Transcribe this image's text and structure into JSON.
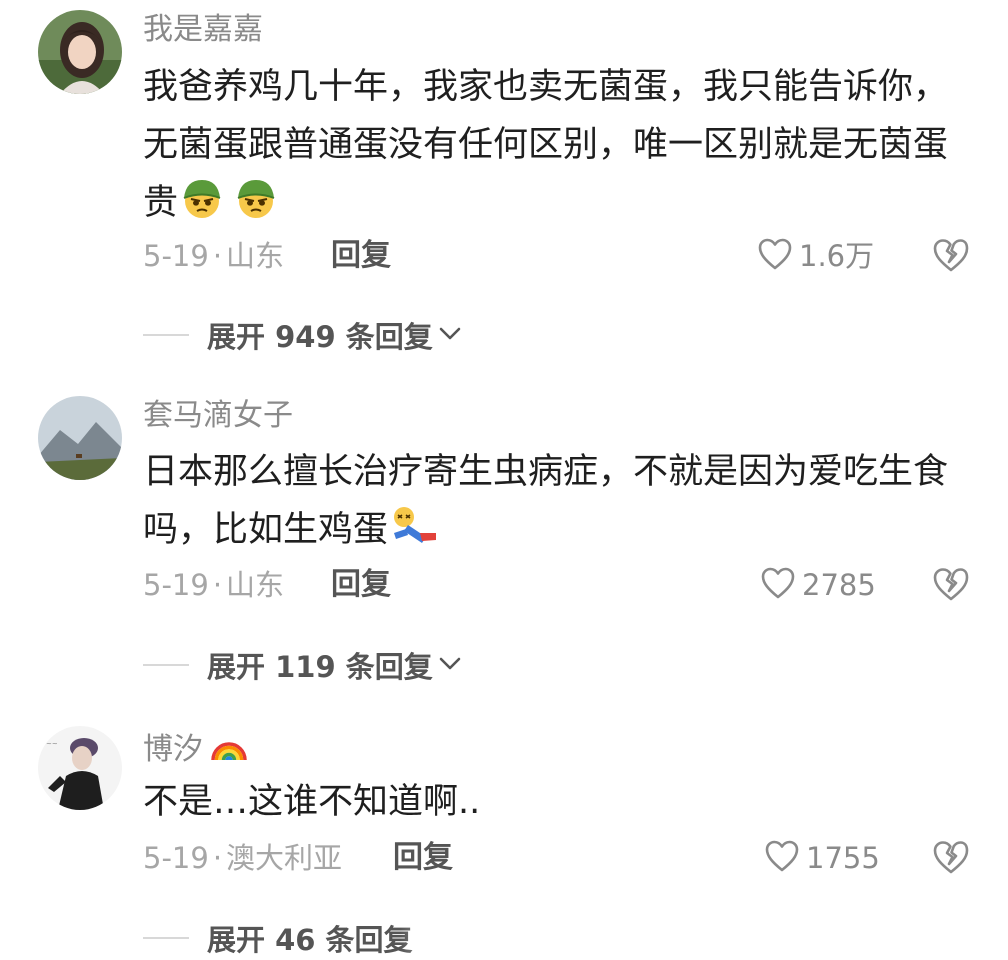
{
  "comments": [
    {
      "username": "我是嘉嘉",
      "text": "我爸养鸡几十年，我家也卖无菌蛋，我只能告诉你，无菌蛋跟普通蛋没有任何区别，唯一区别就是无茵蛋贵",
      "text_emojis": [
        "soldier-face-emoji",
        "soldier-face-emoji"
      ],
      "date": "5-19",
      "separator": "·",
      "location": "山东",
      "reply_label": "回复",
      "likes": "1.6万",
      "expand_label": "展开 949 条回复"
    },
    {
      "username": "套马滴女子",
      "text": "日本那么擅长治疗寄生虫病症，不就是因为爱吃生食吗，比如生鸡蛋",
      "text_emojis": [
        "fainted-person-emoji"
      ],
      "date": "5-19",
      "separator": "·",
      "location": "山东",
      "reply_label": "回复",
      "likes": "2785",
      "expand_label": "展开 119 条回复"
    },
    {
      "username": "博汐",
      "username_emoji": "rainbow-emoji",
      "text": "不是…这谁不知道啊..",
      "date": "5-19",
      "separator": "·",
      "location": "澳大利亚",
      "reply_label": "回复",
      "likes": "1755",
      "expand_label": "展开 46 条回复"
    }
  ],
  "colors": {
    "text": "#1f1f1f",
    "muted": "#8a8a8a",
    "meta": "#a6a6a6",
    "reply": "#555555",
    "divider": "#d8d8d8"
  }
}
